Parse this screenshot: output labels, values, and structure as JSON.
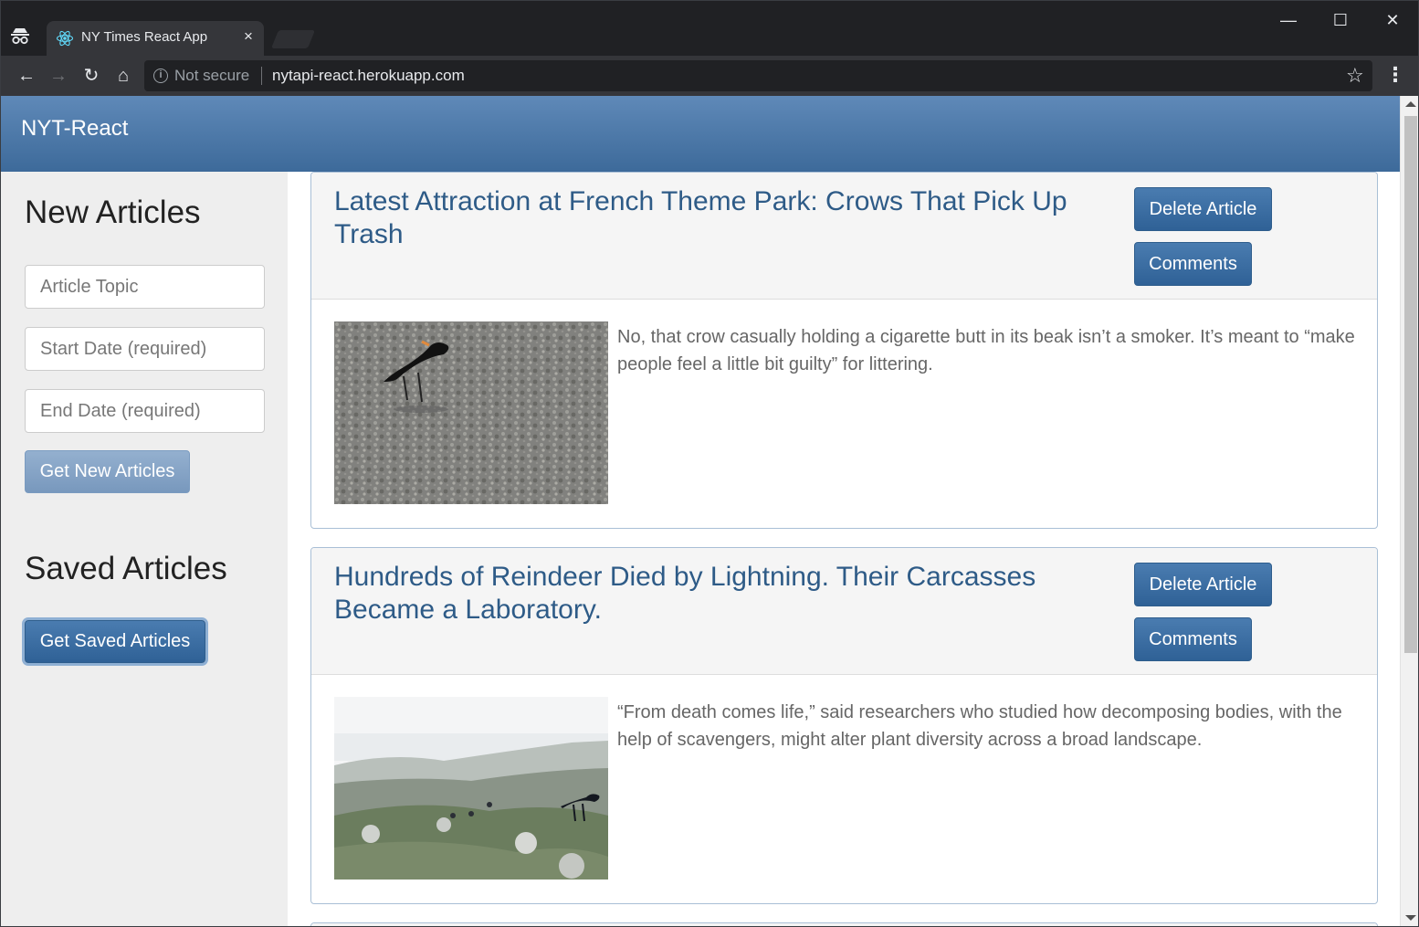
{
  "browser": {
    "tab_title": "NY Times React App",
    "tab_close": "×",
    "security_label": "Not secure",
    "url": "nytapi-react.herokuapp.com",
    "minimize": "—",
    "maximize": "☐",
    "close": "✕",
    "back": "←",
    "forward": "→",
    "reload": "↻",
    "home": "⌂",
    "bookmark": "☆",
    "menu": "⋮",
    "info": "i"
  },
  "app": {
    "brand": "NYT-React",
    "accent_color": "#3d6a9a"
  },
  "sidebar": {
    "new_heading": "New Articles",
    "topic_placeholder": "Article Topic",
    "start_placeholder": "Start Date (required)",
    "end_placeholder": "End Date (required)",
    "get_new_label": "Get New Articles",
    "saved_heading": "Saved Articles",
    "get_saved_label": "Get Saved Articles"
  },
  "articles": [
    {
      "title": "Latest Attraction at French Theme Park: Crows That Pick Up Trash",
      "snippet": "No, that crow casually holding a cigarette butt in its beak isn’t a smoker. It’s meant to “make people feel a little bit guilty” for littering.",
      "delete_label": "Delete Article",
      "comments_label": "Comments",
      "image": "crow-on-gravel"
    },
    {
      "title": "Hundreds of Reindeer Died by Lightning. Their Carcasses Became a Laboratory.",
      "snippet": "“From death comes life,” said researchers who studied how decomposing bodies, with the help of scavengers, might alter plant diversity across a broad landscape.",
      "delete_label": "Delete Article",
      "comments_label": "Comments",
      "image": "raven-on-tundra"
    }
  ]
}
